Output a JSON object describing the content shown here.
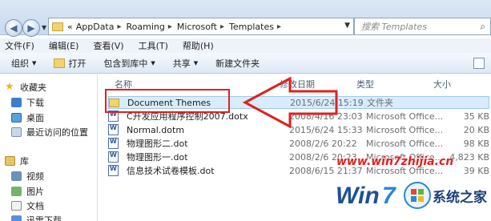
{
  "address": {
    "crumbs": [
      "«",
      "AppData",
      "Roaming",
      "Microsoft",
      "Templates"
    ],
    "search_placeholder": "搜索 Templates"
  },
  "menu": [
    "文件(F)",
    "编辑(E)",
    "查看(V)",
    "工具(T)",
    "帮助(H)"
  ],
  "toolbar": {
    "organize": "组织",
    "open": "打开",
    "include": "包含到库中",
    "share": "共享",
    "new_folder": "新建文件夹"
  },
  "nav": {
    "favorites": "收藏夹",
    "downloads": "下载",
    "desktop": "桌面",
    "recent": "最近访问的位置",
    "libraries": "库",
    "videos": "视频",
    "pictures": "图片",
    "documents": "文档",
    "music": "迅雷下载"
  },
  "columns": {
    "name": "名称",
    "date": "修改日期",
    "type": "类型",
    "size": "大小"
  },
  "files": [
    {
      "name": "Document Themes",
      "date": "2015/6/24 15:19",
      "type": "文件夹",
      "size": "",
      "icon": "folder-icon"
    },
    {
      "name": "C开发应用程序控制2007.dotx",
      "date": "2008/4/16 23:03",
      "type": "Microsoft Office...",
      "size": "35 KB",
      "icon": "word-icon"
    },
    {
      "name": "Normal.dotm",
      "date": "2015/6/24 15:33",
      "type": "Microsoft Office...",
      "size": "20 KB",
      "icon": "word-icon"
    },
    {
      "name": "物理图形二.dot",
      "date": "2008/2/6 20:22",
      "type": "Microsoft Office...",
      "size": "98 KB",
      "icon": "word-icon"
    },
    {
      "name": "物理图形一.dot",
      "date": "2008/2/6 20:23",
      "type": "Microsoft Office...",
      "size": "4,823 KB",
      "icon": "word-icon"
    },
    {
      "name": "信息技术试卷模板.dot",
      "date": "2008/6/15 21:37",
      "type": "Microsoft Office...",
      "size": "39 KB",
      "icon": "word-icon"
    }
  ],
  "watermark": {
    "url": "www.win7zhijia.cn",
    "brand": "系统之家"
  },
  "colors": {
    "annotation": "#e0201f",
    "selection": "#d9ecfb"
  }
}
